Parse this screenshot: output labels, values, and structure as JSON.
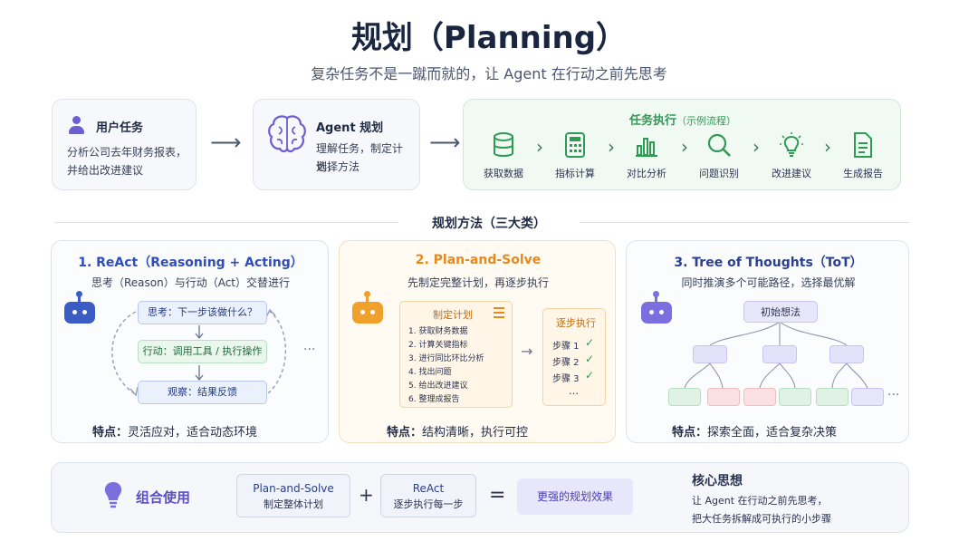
{
  "header": {
    "title": "规划（Planning）",
    "subtitle": "复杂任务不是一蹴而就的，让 Agent 在行动之前先思考"
  },
  "user_task": {
    "title": "用户任务",
    "desc_line1": "分析公司去年财务报表，",
    "desc_line2": "并给出改进建议"
  },
  "agent_plan": {
    "title": "Agent 规划",
    "desc_line1": "理解任务，制定计划，",
    "desc_line2": "选择方法"
  },
  "execution": {
    "title": "任务执行",
    "title_note": "（示例流程）",
    "steps": [
      "获取数据",
      "指标计算",
      "对比分析",
      "问题识别",
      "改进建议",
      "生成报告"
    ]
  },
  "methods_heading": "规划方法（三大类）",
  "react": {
    "title": "1. ReAct（Reasoning + Acting）",
    "subtitle": "思考（Reason）与行动（Act）交替进行",
    "think": "思考：下一步该做什么？",
    "act": "行动：调用工具 / 执行操作",
    "observe": "观察：结果反馈",
    "ellipsis": "···",
    "feature_label": "特点：",
    "feature": "灵活应对，适合动态环境"
  },
  "plan_solve": {
    "title": "2. Plan-and-Solve",
    "subtitle": "先制定完整计划，再逐步执行",
    "plan_title": "制定计划",
    "plan_items": [
      "1.  获取财务数据",
      "2.  计算关键指标",
      "3.  进行同比环比分析",
      "4.  找出问题",
      "5.  给出改进建议",
      "6.  整理成报告"
    ],
    "exec_title": "逐步执行",
    "exec_steps": [
      "步骤 1",
      "步骤 2",
      "步骤 3"
    ],
    "exec_more": "…",
    "feature_label": "特点：",
    "feature": "结构清晰，执行可控"
  },
  "tot": {
    "title": "3. Tree of Thoughts（ToT）",
    "subtitle": "同时推演多个可能路径，选择最优解",
    "root": "初始想法",
    "ellipsis": "···",
    "feature_label": "特点：",
    "feature": "探索全面，适合复杂决策"
  },
  "bottom": {
    "combo_label": "组合使用",
    "box1_line1": "Plan-and-Solve",
    "box1_line2": "制定整体计划",
    "plus": "+",
    "box2_line1": "ReAct",
    "box2_line2": "逐步执行每一步",
    "equals": "=",
    "result": "更强的规划效果",
    "core_title": "核心思想",
    "core_line1": "让 Agent 在行动之前先思考，",
    "core_line2": "把大任务拆解成可执行的小步骤"
  },
  "colors": {
    "react_accent": "#2f4db8",
    "plan_accent": "#e58a1f",
    "tot_accent": "#2a3f8f",
    "exec_green": "#2e9b55",
    "purple": "#6b5fd3"
  }
}
